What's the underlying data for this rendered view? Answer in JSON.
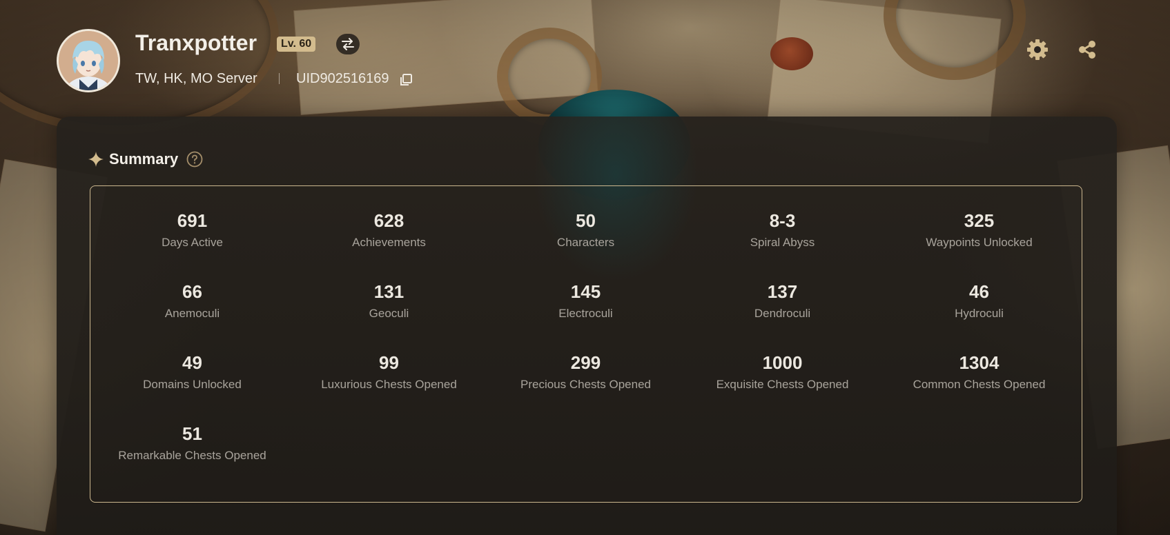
{
  "header": {
    "player_name": "Tranxpotter",
    "level": "Lv. 60",
    "server": "TW, HK, MO Server",
    "uid": "UID902516169",
    "icons": {
      "switch": "swap-arrows-icon",
      "copy": "copy-icon",
      "settings": "gear-icon",
      "share": "share-icon"
    }
  },
  "summary": {
    "title": "Summary",
    "icons": {
      "title": "sparkle-icon",
      "help": "question-icon"
    },
    "stats": [
      {
        "value": "691",
        "label": "Days Active"
      },
      {
        "value": "628",
        "label": "Achievements"
      },
      {
        "value": "50",
        "label": "Characters"
      },
      {
        "value": "8-3",
        "label": "Spiral Abyss"
      },
      {
        "value": "325",
        "label": "Waypoints Unlocked"
      },
      {
        "value": "66",
        "label": "Anemoculi"
      },
      {
        "value": "131",
        "label": "Geoculi"
      },
      {
        "value": "145",
        "label": "Electroculi"
      },
      {
        "value": "137",
        "label": "Dendroculi"
      },
      {
        "value": "46",
        "label": "Hydroculi"
      },
      {
        "value": "49",
        "label": "Domains Unlocked"
      },
      {
        "value": "99",
        "label": "Luxurious Chests Opened"
      },
      {
        "value": "299",
        "label": "Precious Chests Opened"
      },
      {
        "value": "1000",
        "label": "Exquisite Chests Opened"
      },
      {
        "value": "1304",
        "label": "Common Chests Opened"
      },
      {
        "value": "51",
        "label": "Remarkable Chests Opened"
      }
    ]
  },
  "colors": {
    "accent_gold": "#d3bc8e",
    "card_bg": "#25221d",
    "stat_value": "#ece8e0",
    "stat_label": "#a9a49c",
    "border": "#cdb88f"
  }
}
